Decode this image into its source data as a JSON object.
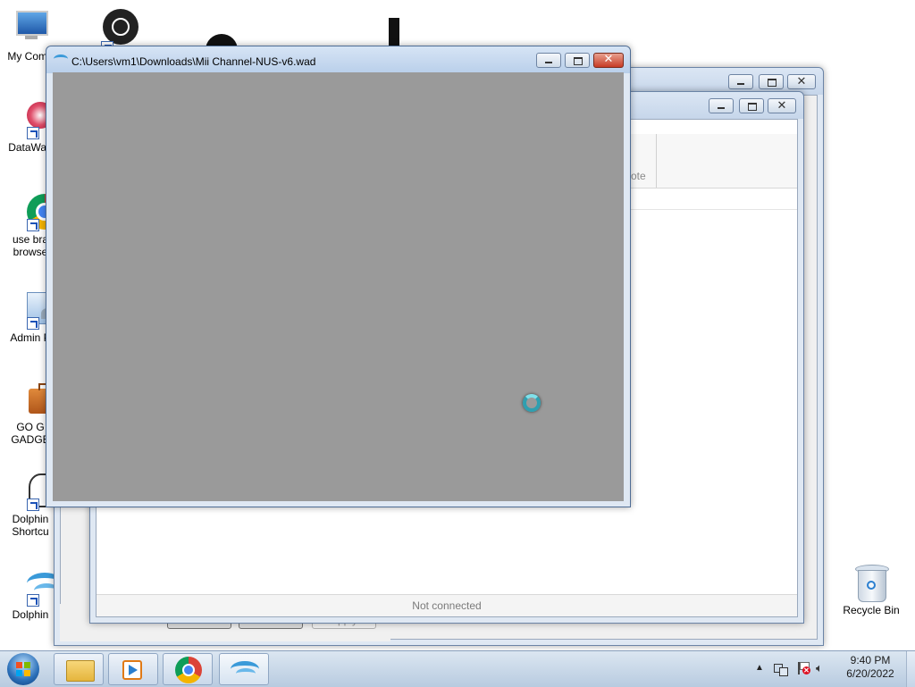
{
  "desktop": {
    "icons": [
      {
        "label": "My Comp"
      },
      {
        "label": "DataWag"
      },
      {
        "label": "use bra browse"
      },
      {
        "label": "Admin P"
      },
      {
        "label": "GO G GADGE"
      },
      {
        "label": "Dolphin Shortcu"
      },
      {
        "label": "Dolphin"
      },
      {
        "label": "Recycle Bin"
      }
    ]
  },
  "active_window": {
    "title": "C:\\Users\\vm1\\Downloads\\Mii Channel-NUS-v6.wad",
    "canvas_color": "#9a9a9a"
  },
  "back_window": {
    "status": "Not connected",
    "tab_fragment": "ote",
    "buttons": [
      "OK",
      "Cancel",
      "Apply"
    ]
  },
  "taskbar": {
    "time": "9:40 PM",
    "date": "6/20/2022"
  }
}
